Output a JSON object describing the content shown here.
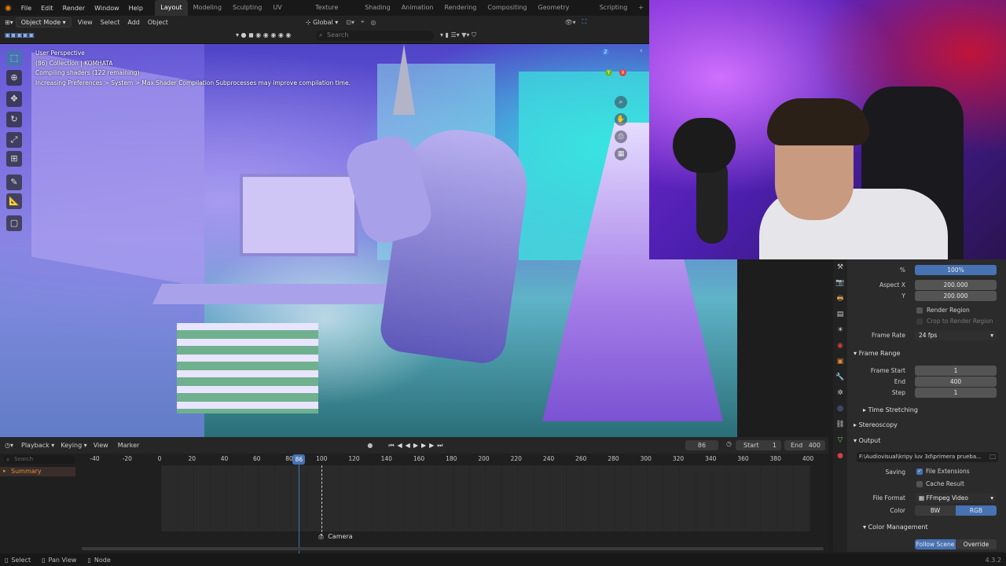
{
  "app": {
    "name": "Blender",
    "version": "4.3.2"
  },
  "menu": [
    "File",
    "Edit",
    "Render",
    "Window",
    "Help"
  ],
  "workspaces": [
    "Layout",
    "Modeling",
    "Sculpting",
    "UV Editing",
    "Texture Paint",
    "Shading",
    "Animation",
    "Rendering",
    "Compositing",
    "Geometry Nodes",
    "Scripting"
  ],
  "active_workspace": "Layout",
  "header": {
    "mode": "Object Mode",
    "menus": [
      "View",
      "Select",
      "Add",
      "Object"
    ],
    "orientation": "Global",
    "search_placeholder": "Search"
  },
  "viewport": {
    "overlay": [
      "User Perspective",
      "(86) Collection | KOMHATA",
      "Compiling shaders (122 remaining)",
      "Increasing Preferences > System > Max Shader Compilation Subprocesses may improve compilation time."
    ],
    "gizmo_axes": [
      "Z",
      "Y",
      "X"
    ]
  },
  "timeline": {
    "menus": [
      "Playback",
      "Keying",
      "View",
      "Marker"
    ],
    "current_frame": "86",
    "start_label": "Start",
    "start": "1",
    "end_label": "End",
    "end": "400",
    "search_placeholder": "Search",
    "channel": "Summary",
    "ruler": [
      "-40",
      "-20",
      "0",
      "20",
      "40",
      "60",
      "80",
      "100",
      "120",
      "140",
      "160",
      "180",
      "200",
      "220",
      "240",
      "260",
      "280",
      "300",
      "320",
      "340",
      "360",
      "380",
      "400"
    ],
    "playhead_label": "86",
    "marker": "Camera"
  },
  "properties": {
    "resolution_percent": "100%",
    "aspect_x_label": "Aspect X",
    "aspect_x": "200.000",
    "aspect_y_label": "Y",
    "aspect_y": "200.000",
    "render_region": "Render Region",
    "crop_region": "Crop to Render Region",
    "frame_rate_label": "Frame Rate",
    "frame_rate": "24 fps",
    "frame_range_title": "Frame Range",
    "frame_start_label": "Frame Start",
    "frame_start": "1",
    "end_label": "End",
    "end": "400",
    "step_label": "Step",
    "step": "1",
    "time_stretching": "Time Stretching",
    "stereoscopy": "Stereoscopy",
    "output_title": "Output",
    "output_path": "F:\\Audiovisual\\kripy luv 3d\\primera prueba...",
    "saving_label": "Saving",
    "file_extensions": "File Extensions",
    "cache_result": "Cache Result",
    "file_format_label": "File Format",
    "file_format": "FFmpeg Video",
    "color_label": "Color",
    "color_bw": "BW",
    "color_rgb": "RGB",
    "color_management": "Color Management",
    "follow_scene": "Follow Scene",
    "override": "Override"
  },
  "statusbar": {
    "select": "Select",
    "pan": "Pan View",
    "node": "Node",
    "version": "4.3.2"
  },
  "colors": {
    "accent": "#4772b3",
    "timeline_playhead": "#4772b3",
    "summary": "#e08a3c"
  }
}
